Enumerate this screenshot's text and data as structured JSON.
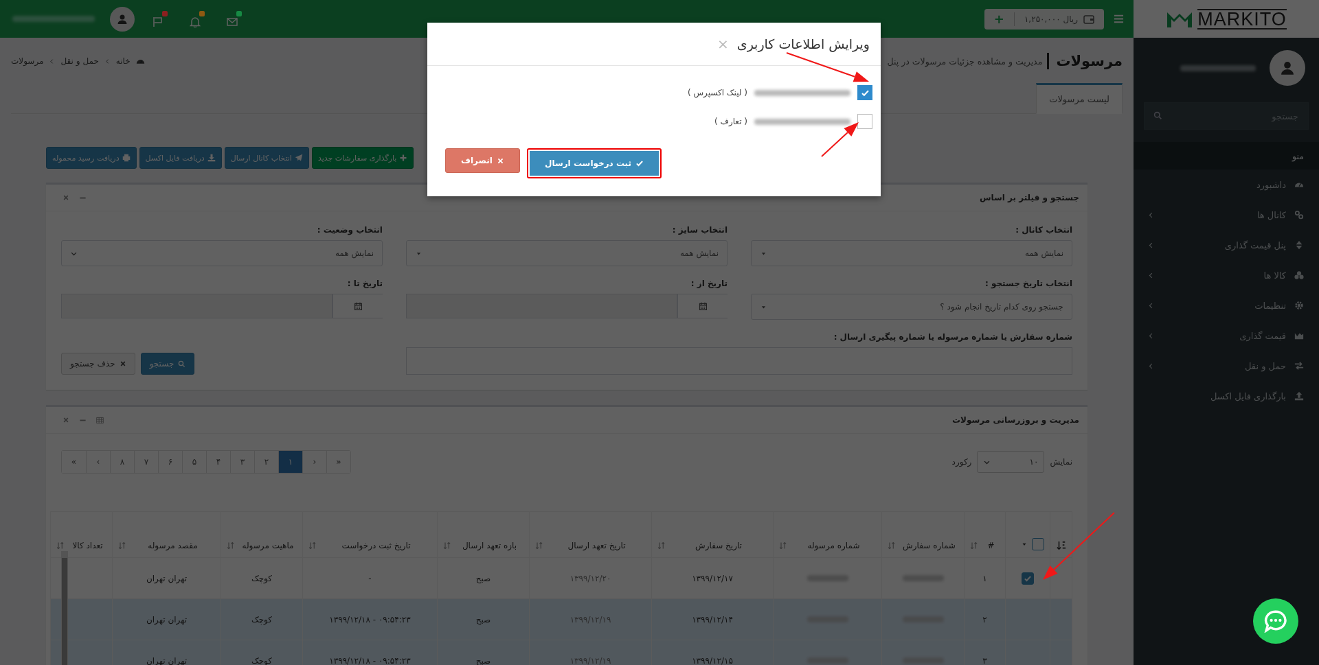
{
  "topbar": {
    "balance": "۱,۲۵۰,۰۰۰ ریال",
    "add": "+",
    "notifications": [
      {
        "kind": "envelope",
        "color": "#178a44"
      },
      {
        "kind": "bell",
        "color": "#8f5a12"
      },
      {
        "kind": "flag",
        "color": "#8c2020"
      }
    ]
  },
  "sidebar": {
    "logo": "MARKITO",
    "search": {
      "placeholder": "جستجو"
    },
    "section": "منو",
    "items": [
      {
        "label": "داشبورد",
        "has_submenu": false
      },
      {
        "label": "کانال ها",
        "has_submenu": true
      },
      {
        "label": "پنل قیمت گذاری",
        "has_submenu": true
      },
      {
        "label": "کالا ها",
        "has_submenu": true
      },
      {
        "label": "تنظیمات",
        "has_submenu": true
      },
      {
        "label": "قیمت گذاری",
        "has_submenu": true
      },
      {
        "label": "حمل و نقل",
        "has_submenu": true
      },
      {
        "label": "بارگذاری فایل اکسل",
        "has_submenu": false
      }
    ]
  },
  "page": {
    "title": "مرسولات",
    "subtitle": "مدیریت و مشاهده جزئیات مرسولات در پنل",
    "breadcrumb": [
      "خانه",
      "حمل و نقل",
      "مرسولات"
    ]
  },
  "tabs": [
    {
      "label": "لیست مرسولات",
      "selected": true
    }
  ],
  "actions": [
    {
      "label": "بارگذاری سفارشات جدید",
      "kind": "success"
    },
    {
      "label": "انتخاب کانال ارسال",
      "kind": "primary"
    },
    {
      "label": "دریافت فایل اکسل",
      "kind": "primary"
    },
    {
      "label": "دریافت رسید محموله",
      "kind": "primary"
    }
  ],
  "filter_panel": {
    "title": "جستجو و فیلتر بر اساس",
    "fields": [
      {
        "label": "انتخاب کانال :",
        "kind": "select",
        "value": "نمایش همه"
      },
      {
        "label": "انتخاب سایز :",
        "kind": "select",
        "value": "نمایش همه"
      },
      {
        "label": "انتخاب وضعیت :",
        "kind": "native-select",
        "value": "نمایش همه"
      },
      {
        "label": "انتخاب تاریخ جستجو :",
        "kind": "select",
        "value": "جستجو روی کدام تاریخ انجام شود ؟"
      },
      {
        "label": "تاریخ از :",
        "kind": "date"
      },
      {
        "label": "تاریخ تا :",
        "kind": "date"
      },
      {
        "label": "شماره سفارش یا شماره مرسوله یا شماره پیگیری ارسال :",
        "kind": "text"
      }
    ],
    "buttons": [
      {
        "label": "جستجو",
        "kind": "primary"
      },
      {
        "label": "حذف جستجو",
        "kind": "default"
      }
    ]
  },
  "table_panel": {
    "title": "مدیریت و بروزرسانی مرسولات",
    "length": {
      "prefix": "نمایش",
      "value": "۱۰",
      "suffix": "رکورد"
    },
    "pagination": [
      {
        "label": "«",
        "selected": false
      },
      {
        "label": "‹",
        "selected": false
      },
      {
        "label": "۱",
        "selected": true
      },
      {
        "label": "۲",
        "selected": false
      },
      {
        "label": "۳",
        "selected": false
      },
      {
        "label": "۴",
        "selected": false
      },
      {
        "label": "۵",
        "selected": false
      },
      {
        "label": "۶",
        "selected": false
      },
      {
        "label": "۷",
        "selected": false
      },
      {
        "label": "۸",
        "selected": false
      },
      {
        "label": "›",
        "selected": false
      },
      {
        "label": "»",
        "selected": false
      }
    ],
    "select_all": {
      "checked": false
    },
    "columns": [
      "#",
      "شماره سفارش",
      "شماره مرسوله",
      "تاریخ سفارش",
      "تاریخ تعهد ارسال",
      "بازه تعهد ارسال",
      "تاریخ ثبت درخواست",
      "ماهیت مرسوله",
      "مقصد مرسوله",
      "تعداد کالا"
    ],
    "rows": [
      {
        "checked": true,
        "selected": false,
        "cells": [
          {
            "text": "۱"
          },
          {
            "blurred": true
          },
          {
            "blurred": true
          },
          {
            "text": "۱۳۹۹/۱۲/۱۷"
          },
          {
            "text": "۱۳۹۹/۱۲/۲۰"
          },
          {
            "text": "صبح"
          },
          {
            "text": "-"
          },
          {
            "text": "کوچک"
          },
          {
            "text": "تهران تهران"
          }
        ]
      },
      {
        "checked": false,
        "selected": true,
        "cells": [
          {
            "text": "۲"
          },
          {
            "blurred": true
          },
          {
            "blurred": true
          },
          {
            "text": "۱۳۹۹/۱۲/۱۴"
          },
          {
            "text": "۱۳۹۹/۱۲/۱۹"
          },
          {
            "text": "صبح"
          },
          {
            "text": "۰۹:۵۴:۲۳ - ۱۳۹۹/۱۲/۱۸"
          },
          {
            "text": "کوچک"
          },
          {
            "text": "تهران تهران"
          }
        ]
      },
      {
        "checked": false,
        "selected": true,
        "cells": [
          {
            "text": "۳"
          },
          {
            "blurred": true
          },
          {
            "blurred": true
          },
          {
            "text": "۱۳۹۹/۱۲/۱۵"
          },
          {
            "text": "۱۳۹۹/۱۲/۱۹"
          },
          {
            "text": "صبح"
          },
          {
            "text": "۰۹:۵۴:۲۳ - ۱۳۹۹/۱۲/۱۸"
          },
          {
            "text": "کوچک"
          },
          {
            "text": "تهران تهران"
          }
        ]
      }
    ]
  },
  "modal": {
    "title": "ویرایش اطلاعات کاربری",
    "close": "×",
    "options": [
      {
        "checked": true,
        "label": "( لینک اکسپرس )"
      },
      {
        "checked": false,
        "label": "( تعارف )"
      }
    ],
    "buttons": [
      {
        "label": "ثبت درخواست ارسال",
        "kind": "primary",
        "highlighted": true
      },
      {
        "label": "انصراف",
        "kind": "danger",
        "highlighted": false
      }
    ]
  }
}
